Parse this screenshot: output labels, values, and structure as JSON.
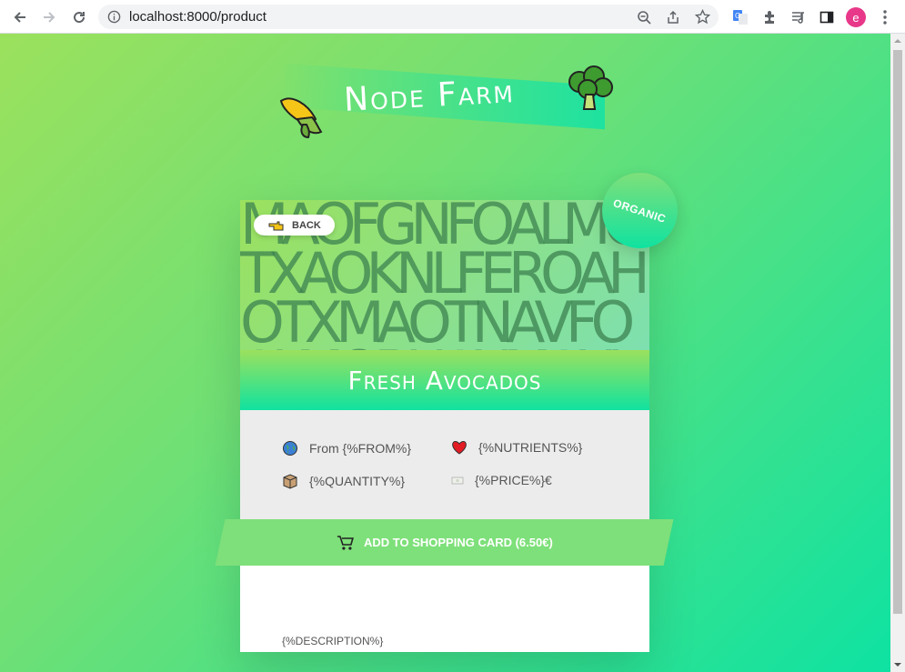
{
  "browser": {
    "url": "localhost:8000/product",
    "profile_initial": "e"
  },
  "logo": {
    "text": "Node Farm"
  },
  "organic_badge": "ORGANIC",
  "product": {
    "back_label": "BACK",
    "image_text": "MAOFGNFOALMOTXAOKNLFEROAHOTXMAOTNAVFOALMOBHAXMAXIOFVOSLHAOTAXKAOHSHANOMOTXAO",
    "name": "Fresh Avocados",
    "from": "From {%FROM%}",
    "nutrients": "{%NUTRIENTS%}",
    "quantity": "{%QUANTITY%}",
    "price": "{%PRICE%}€",
    "add_to_cart": "ADD TO SHOPPING CARD (6.50€)",
    "description": "{%DESCRIPTION%}"
  }
}
